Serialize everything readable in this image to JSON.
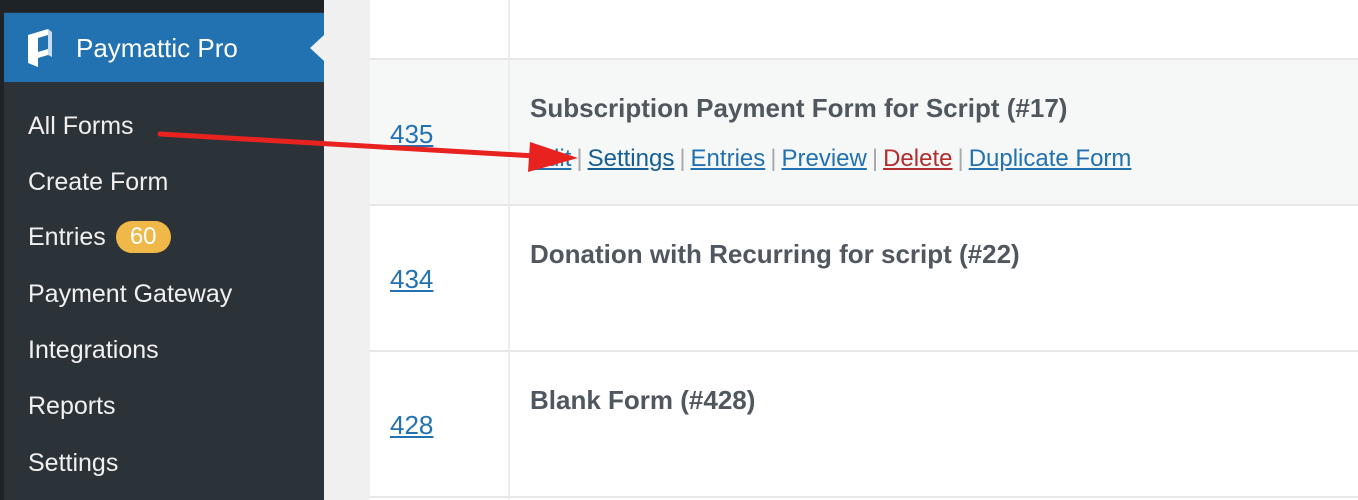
{
  "sidebar": {
    "plugin_title": "Paymattic Pro",
    "items": [
      {
        "label": "All Forms"
      },
      {
        "label": "Create Form"
      },
      {
        "label": "Entries",
        "badge": "60"
      },
      {
        "label": "Payment Gateway"
      },
      {
        "label": "Integrations"
      },
      {
        "label": "Reports"
      },
      {
        "label": "Settings"
      }
    ]
  },
  "forms_table": {
    "rows": [
      {
        "id": "",
        "title": ""
      },
      {
        "id": "435",
        "title": "Subscription Payment Form for Script (#17)",
        "actions": {
          "edit": "Edit",
          "settings": "Settings",
          "entries": "Entries",
          "preview": "Preview",
          "delete": "Delete",
          "duplicate": "Duplicate Form"
        }
      },
      {
        "id": "434",
        "title": "Donation with Recurring for script (#22)"
      },
      {
        "id": "428",
        "title": "Blank Form (#428)"
      }
    ]
  },
  "colors": {
    "sidebar_bg": "#2c3338",
    "active_menu": "#2271b1",
    "link": "#2271b1",
    "delete_link": "#b32d2e",
    "badge": "#f0b849",
    "annotation_arrow": "#e8231f"
  },
  "icons": {
    "plugin_logo": "paymattic-logo-icon"
  }
}
